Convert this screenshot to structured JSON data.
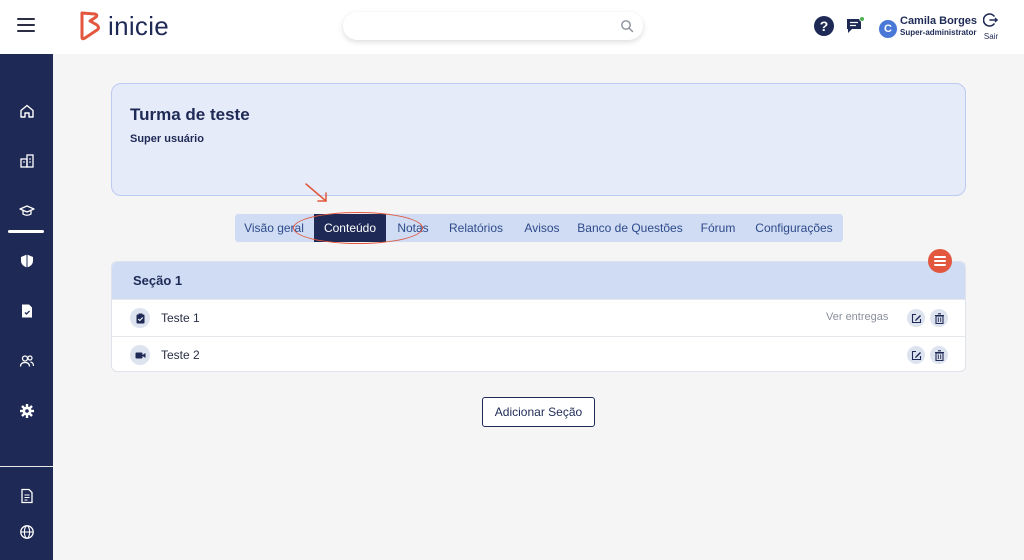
{
  "brand": {
    "name": "inicie",
    "accent": "#e2573e",
    "navy": "#1e2a55"
  },
  "search": {
    "placeholder": ""
  },
  "user": {
    "initial": "C",
    "name": "Camila Borges",
    "role": "Super-administrator",
    "logout_label": "Sair"
  },
  "sidebar": {
    "items": [
      {
        "icon": "home-icon"
      },
      {
        "icon": "building-icon"
      },
      {
        "icon": "graduation-cap-icon",
        "active": true
      },
      {
        "icon": "shield-icon"
      },
      {
        "icon": "file-icon"
      },
      {
        "icon": "users-icon"
      },
      {
        "icon": "gear-icon"
      },
      {
        "icon": "report-icon"
      },
      {
        "icon": "globe-icon"
      }
    ]
  },
  "class_card": {
    "title": "Turma de teste",
    "subtitle": "Super usuário"
  },
  "tabs": [
    {
      "label": "Visão geral"
    },
    {
      "label": "Conteúdo",
      "active": true
    },
    {
      "label": "Notas"
    },
    {
      "label": "Relatórios"
    },
    {
      "label": "Avisos"
    },
    {
      "label": "Banco de Questões"
    },
    {
      "label": "Fórum"
    },
    {
      "label": "Configurações"
    }
  ],
  "section": {
    "title": "Seção 1",
    "items": [
      {
        "label": "Teste 1",
        "type": "task",
        "link": "Ver entregas"
      },
      {
        "label": "Teste 2",
        "type": "video",
        "link": ""
      }
    ]
  },
  "add_section_label": "Adicionar Seção"
}
